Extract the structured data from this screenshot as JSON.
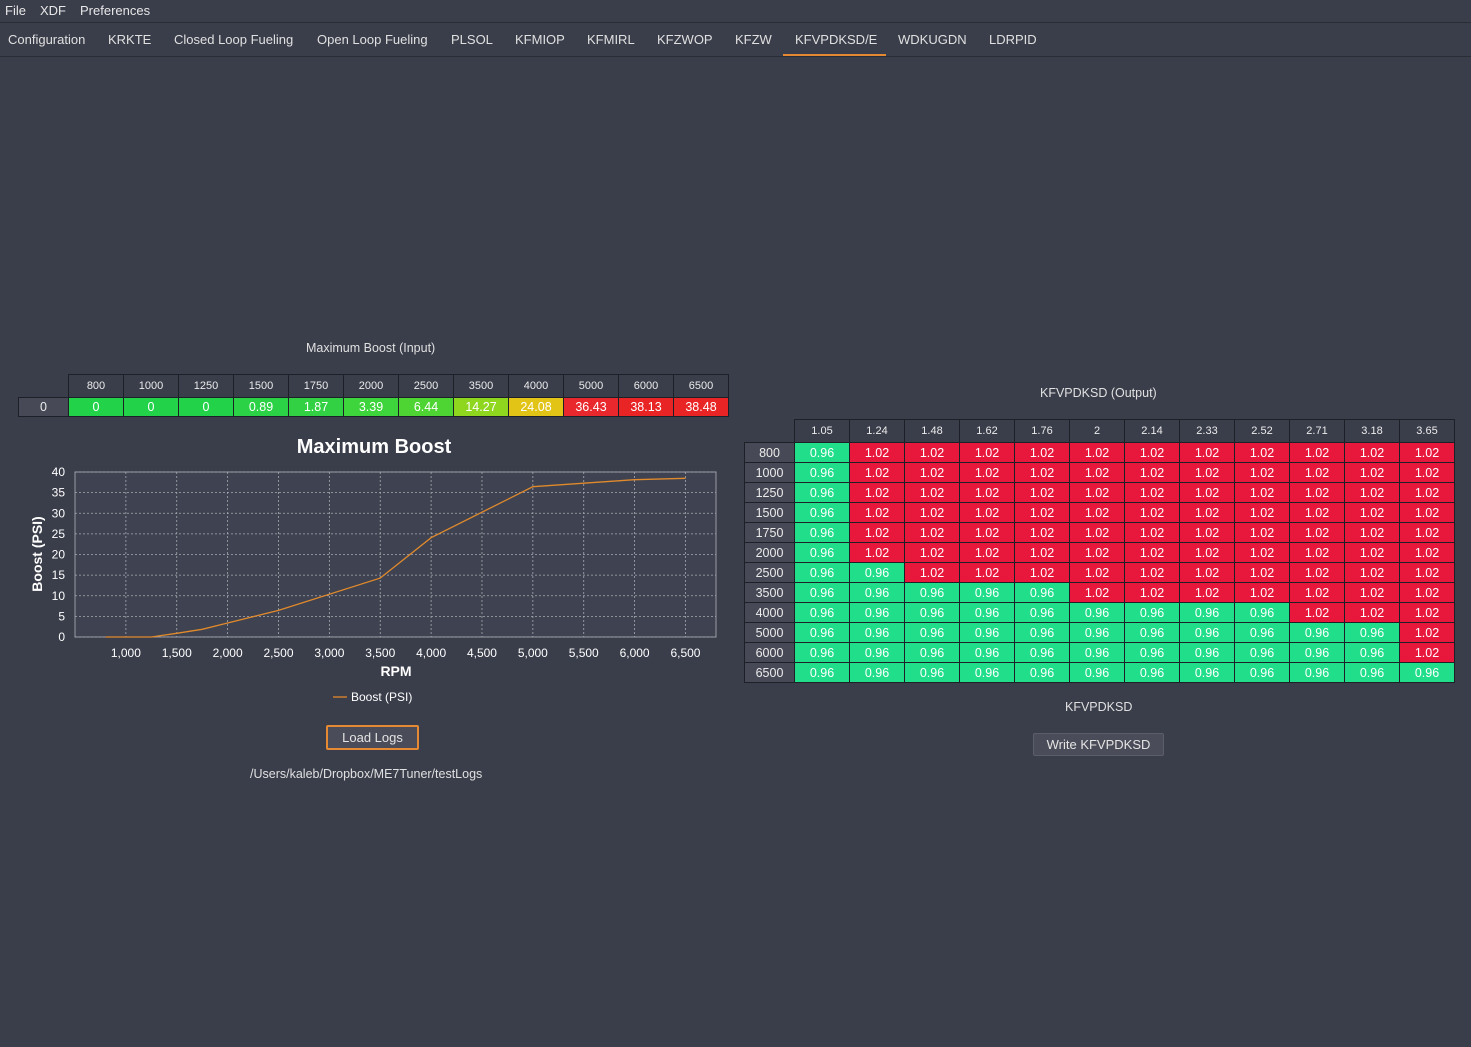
{
  "menu": {
    "items": [
      "File",
      "XDF",
      "Preferences"
    ]
  },
  "tabs": [
    "Configuration",
    "KRKTE",
    "Closed Loop Fueling",
    "Open Loop Fueling",
    "PLSOL",
    "KFMIOP",
    "KFMIRL",
    "KFZWOP",
    "KFZW",
    "KFVPDKSD/E",
    "WDKUGDN",
    "LDRPID"
  ],
  "active_tab": "KFVPDKSD/E",
  "input": {
    "title": "Maximum Boost (Input)",
    "columns": [
      "800",
      "1000",
      "1250",
      "1500",
      "1750",
      "2000",
      "2500",
      "3500",
      "4000",
      "5000",
      "6000",
      "6500"
    ],
    "row_label": "0",
    "values": [
      "0",
      "0",
      "0",
      "0.89",
      "1.87",
      "3.39",
      "6.44",
      "14.27",
      "24.08",
      "36.43",
      "38.13",
      "38.48"
    ],
    "cell_colors": [
      "#22d34a",
      "#22d34a",
      "#22d34a",
      "#2bd246",
      "#32d143",
      "#3ed43c",
      "#4ed433",
      "#8fd61f",
      "#e2c417",
      "#e8282c",
      "#e82424",
      "#e82424"
    ]
  },
  "chart": {
    "legend_label": "Boost (PSI)",
    "line_color": "#e08a2c"
  },
  "chart_data": {
    "type": "line",
    "title": "Maximum Boost",
    "xlabel": "RPM",
    "ylabel": "Boost (PSI)",
    "x": [
      800,
      1000,
      1250,
      1500,
      1750,
      2000,
      2500,
      3500,
      4000,
      5000,
      6000,
      6500
    ],
    "series": [
      {
        "name": "Boost (PSI)",
        "values": [
          0,
          0,
          0,
          0.89,
          1.87,
          3.39,
          6.44,
          14.27,
          24.08,
          36.43,
          38.13,
          38.48
        ]
      }
    ],
    "xlim": [
      500,
      6800
    ],
    "ylim": [
      0,
      40
    ],
    "x_ticks": [
      "1,000",
      "1,500",
      "2,000",
      "2,500",
      "3,000",
      "3,500",
      "4,000",
      "4,500",
      "5,000",
      "5,500",
      "6,000",
      "6,500"
    ],
    "x_tick_values": [
      1000,
      1500,
      2000,
      2500,
      3000,
      3500,
      4000,
      4500,
      5000,
      5500,
      6000,
      6500
    ],
    "y_ticks": [
      "0",
      "5",
      "10",
      "15",
      "20",
      "25",
      "30",
      "35",
      "40"
    ],
    "y_tick_values": [
      0,
      5,
      10,
      15,
      20,
      25,
      30,
      35,
      40
    ],
    "grid": true,
    "legend": "bottom"
  },
  "load_logs": {
    "label": "Load Logs",
    "path": "/Users/kaleb/Dropbox/ME7Tuner/testLogs"
  },
  "output": {
    "title": "KFVPDKSD (Output)",
    "columns": [
      "1.05",
      "1.24",
      "1.48",
      "1.62",
      "1.76",
      "2",
      "2.14",
      "2.33",
      "2.52",
      "2.71",
      "3.18",
      "3.65"
    ],
    "rows": [
      "800",
      "1000",
      "1250",
      "1500",
      "1750",
      "2000",
      "2500",
      "3500",
      "4000",
      "5000",
      "6000",
      "6500"
    ],
    "values": [
      [
        "0.96",
        "1.02",
        "1.02",
        "1.02",
        "1.02",
        "1.02",
        "1.02",
        "1.02",
        "1.02",
        "1.02",
        "1.02",
        "1.02"
      ],
      [
        "0.96",
        "1.02",
        "1.02",
        "1.02",
        "1.02",
        "1.02",
        "1.02",
        "1.02",
        "1.02",
        "1.02",
        "1.02",
        "1.02"
      ],
      [
        "0.96",
        "1.02",
        "1.02",
        "1.02",
        "1.02",
        "1.02",
        "1.02",
        "1.02",
        "1.02",
        "1.02",
        "1.02",
        "1.02"
      ],
      [
        "0.96",
        "1.02",
        "1.02",
        "1.02",
        "1.02",
        "1.02",
        "1.02",
        "1.02",
        "1.02",
        "1.02",
        "1.02",
        "1.02"
      ],
      [
        "0.96",
        "1.02",
        "1.02",
        "1.02",
        "1.02",
        "1.02",
        "1.02",
        "1.02",
        "1.02",
        "1.02",
        "1.02",
        "1.02"
      ],
      [
        "0.96",
        "1.02",
        "1.02",
        "1.02",
        "1.02",
        "1.02",
        "1.02",
        "1.02",
        "1.02",
        "1.02",
        "1.02",
        "1.02"
      ],
      [
        "0.96",
        "0.96",
        "1.02",
        "1.02",
        "1.02",
        "1.02",
        "1.02",
        "1.02",
        "1.02",
        "1.02",
        "1.02",
        "1.02"
      ],
      [
        "0.96",
        "0.96",
        "0.96",
        "0.96",
        "0.96",
        "1.02",
        "1.02",
        "1.02",
        "1.02",
        "1.02",
        "1.02",
        "1.02"
      ],
      [
        "0.96",
        "0.96",
        "0.96",
        "0.96",
        "0.96",
        "0.96",
        "0.96",
        "0.96",
        "0.96",
        "1.02",
        "1.02",
        "1.02"
      ],
      [
        "0.96",
        "0.96",
        "0.96",
        "0.96",
        "0.96",
        "0.96",
        "0.96",
        "0.96",
        "0.96",
        "0.96",
        "0.96",
        "1.02"
      ],
      [
        "0.96",
        "0.96",
        "0.96",
        "0.96",
        "0.96",
        "0.96",
        "0.96",
        "0.96",
        "0.96",
        "0.96",
        "0.96",
        "1.02"
      ],
      [
        "0.96",
        "0.96",
        "0.96",
        "0.96",
        "0.96",
        "0.96",
        "0.96",
        "0.96",
        "0.96",
        "0.96",
        "0.96",
        "0.96"
      ]
    ],
    "low_color": "#20de8a",
    "high_color": "#e8173c",
    "caption": "KFVPDKSD",
    "write_label": "Write KFVPDKSD"
  }
}
